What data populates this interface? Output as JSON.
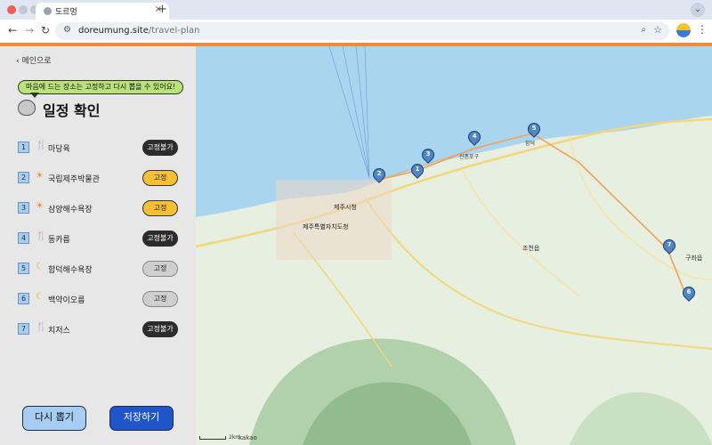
{
  "browser": {
    "tab_title": "도르멍",
    "tab_close": "×",
    "new_tab": "+",
    "tab_more": "⌄",
    "url_host": "doreumung.site",
    "url_path": "/travel-plan",
    "icons": [
      "back-arrow-icon",
      "forward-arrow-icon",
      "reload-icon",
      "site-settings-icon",
      "zoom-icon",
      "star-icon",
      "menu-dots-icon"
    ]
  },
  "colors": {
    "accent": "#ef8a3a",
    "route": "#f0a25a",
    "pin": "#4f86c6",
    "primary_button": "#1f55c9",
    "secondary_button": "#a7cdf2",
    "fixed_on": "#f5c033"
  },
  "sidebar": {
    "back_label": "‹ 메인으로",
    "tip": "마음에 드는 장소는 고정하고 다시 뽑을 수 있어요!",
    "title": "일정 확인",
    "items": [
      {
        "num": "1",
        "icon": "fork-knife-icon",
        "name": "마당육",
        "status": "고정불가"
      },
      {
        "num": "2",
        "icon": "sun-icon",
        "name": "국립제주박물관",
        "status": "고정"
      },
      {
        "num": "3",
        "icon": "sun-icon",
        "name": "삼양해수욕장",
        "status": "고정"
      },
      {
        "num": "4",
        "icon": "fork-knife-icon",
        "name": "동카름",
        "status": "고정불가"
      },
      {
        "num": "5",
        "icon": "moon-icon",
        "name": "함덕해수욕장",
        "status": "고정"
      },
      {
        "num": "6",
        "icon": "moon-icon",
        "name": "백약이오름",
        "status": "고정"
      },
      {
        "num": "7",
        "icon": "fork-knife-icon",
        "name": "치저스",
        "status": "고정불가"
      }
    ],
    "retry_label": "다시 뽑기",
    "save_label": "저장하기"
  },
  "map": {
    "labels": [
      "제주시청",
      "제주특별자치도청",
      "조천읍",
      "신촌포구",
      "함덕",
      "구좌읍"
    ],
    "pins": [
      "1",
      "2",
      "3",
      "4",
      "5",
      "6",
      "7"
    ],
    "scale_label": "2km",
    "brand": "kakao"
  }
}
